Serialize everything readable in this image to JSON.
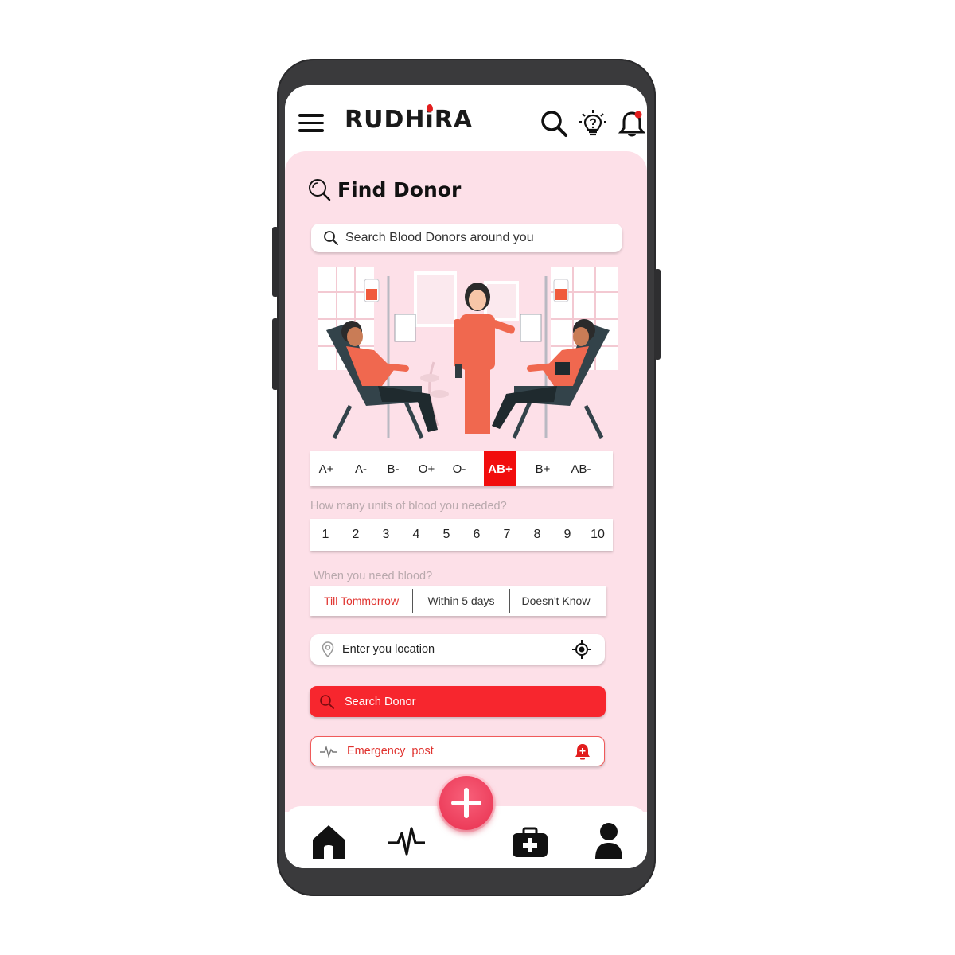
{
  "app": {
    "logo_text_1": "RUDH",
    "logo_text_i": "i",
    "logo_text_2": "RA"
  },
  "header": {
    "icons": [
      "menu-icon",
      "search-icon",
      "lightbulb-question-icon",
      "bell-icon"
    ]
  },
  "find": {
    "title": "Find Donor",
    "search_placeholder": "Search Blood Donors around you"
  },
  "blood_types": [
    "A+",
    "A-",
    "B-",
    "O+",
    "O-",
    "AB+",
    "B+",
    "AB-"
  ],
  "blood_type_selected": "AB+",
  "units": {
    "label": "How many units of blood you needed?",
    "options": [
      "1",
      "2",
      "3",
      "4",
      "5",
      "6",
      "7",
      "8",
      "9",
      "10"
    ]
  },
  "when": {
    "label": "When you need blood?",
    "options": [
      "Till Tommorrow",
      "Within 5 days",
      "Doesn't Know"
    ],
    "selected": "Till Tommorrow"
  },
  "location": {
    "placeholder": "Enter you location"
  },
  "search_button": {
    "label": "Search Donor"
  },
  "emergency": {
    "label": "Emergency  post"
  },
  "bottom_nav": [
    "home-icon",
    "activity-icon",
    "add-icon",
    "medical-kit-icon",
    "profile-icon"
  ],
  "colors": {
    "accent": "#f7262e",
    "selected": "#f10d0d",
    "background": "#fde0e8",
    "fab": "#e8304f"
  }
}
